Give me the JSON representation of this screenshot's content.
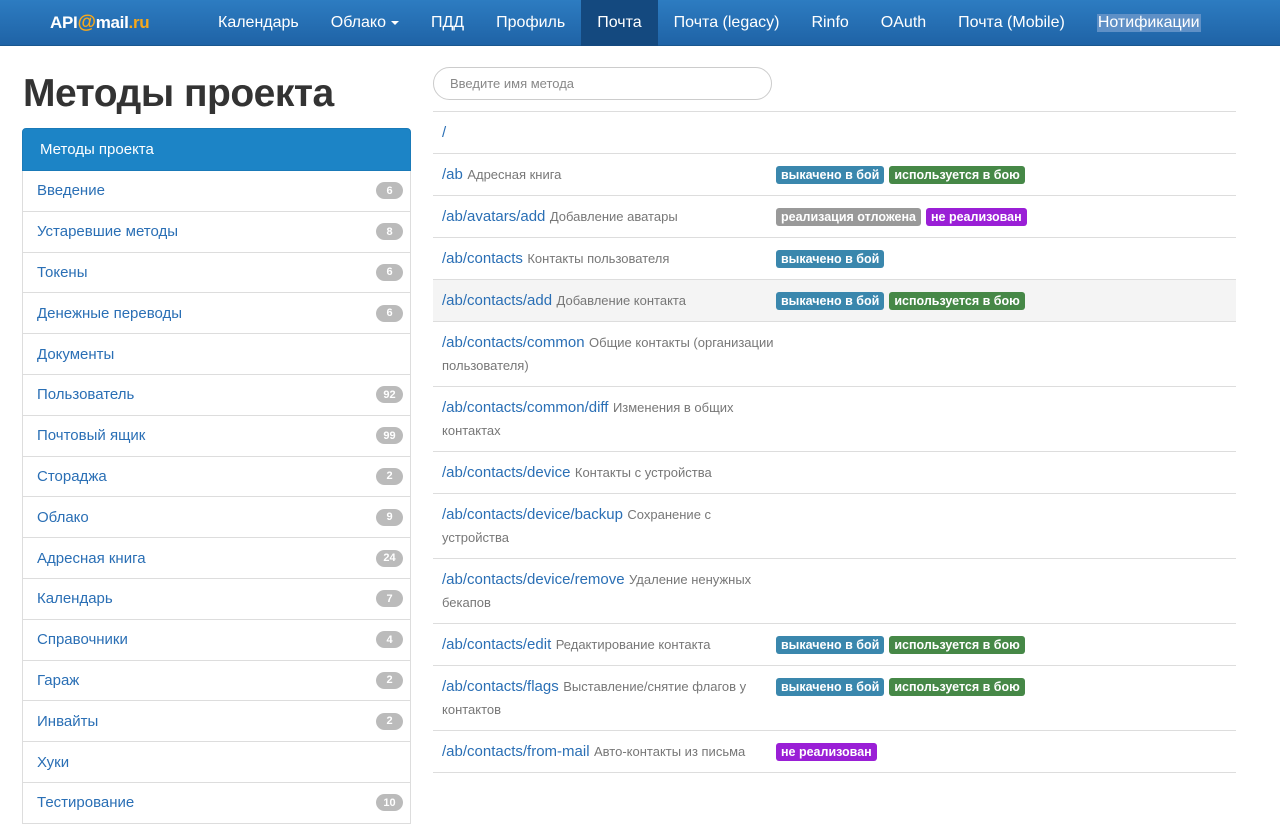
{
  "brand": {
    "api": "API",
    "at": "@",
    "mail": "mail",
    "ru": ".ru"
  },
  "nav": {
    "items": [
      {
        "label": "Календарь"
      },
      {
        "label": "Облако"
      },
      {
        "label": "ПДД"
      },
      {
        "label": "Профиль"
      },
      {
        "label": "Почта"
      },
      {
        "label": "Почта (legacy)"
      },
      {
        "label": "Rinfo"
      },
      {
        "label": "OAuth"
      },
      {
        "label": "Почта (Mobile)"
      },
      {
        "label": "Нотификации"
      }
    ],
    "active_index": 4
  },
  "page": {
    "title": "Методы проекта"
  },
  "sidebar": {
    "header": "Методы проекта",
    "items": [
      {
        "label": "Введение",
        "count": "6"
      },
      {
        "label": "Устаревшие методы",
        "count": "8"
      },
      {
        "label": "Токены",
        "count": "6"
      },
      {
        "label": "Денежные переводы",
        "count": "6"
      },
      {
        "label": "Документы",
        "count": ""
      },
      {
        "label": "Пользователь",
        "count": "92"
      },
      {
        "label": "Почтовый ящик",
        "count": "99"
      },
      {
        "label": "Стораджа",
        "count": "2"
      },
      {
        "label": "Облако",
        "count": "9"
      },
      {
        "label": "Адресная книга",
        "count": "24"
      },
      {
        "label": "Календарь",
        "count": "7"
      },
      {
        "label": "Справочники",
        "count": "4"
      },
      {
        "label": "Гараж",
        "count": "2"
      },
      {
        "label": "Инвайты",
        "count": "2"
      },
      {
        "label": "Хуки",
        "count": ""
      },
      {
        "label": "Тестирование",
        "count": "10"
      }
    ]
  },
  "search": {
    "placeholder": "Введите имя метода",
    "value": ""
  },
  "tag_colors": {
    "выкачено в бой": "#3a87ad",
    "используется в бою": "#468847",
    "реализация отложена": "#999999",
    "не реализован": "#9a1fd6"
  },
  "methods": [
    {
      "path": "/",
      "desc": "",
      "tags": []
    },
    {
      "path": "/ab",
      "desc": "Адресная книга",
      "tags": [
        "выкачено в бой",
        "используется в бою"
      ]
    },
    {
      "path": "/ab/avatars/add",
      "desc": "Добавление аватары",
      "tags": [
        "реализация отложена",
        "не реализован"
      ]
    },
    {
      "path": "/ab/contacts",
      "desc": "Контакты пользователя",
      "tags": [
        "выкачено в бой"
      ]
    },
    {
      "path": "/ab/contacts/add",
      "desc": "Добавление контакта",
      "tags": [
        "выкачено в бой",
        "используется в бою"
      ],
      "striped": true
    },
    {
      "path": "/ab/contacts/common",
      "desc": "Общие контакты (организации пользователя)",
      "tags": []
    },
    {
      "path": "/ab/contacts/common/diff",
      "desc": "Изменения в общих контактах",
      "tags": []
    },
    {
      "path": "/ab/contacts/device",
      "desc": "Контакты с устройства",
      "tags": []
    },
    {
      "path": "/ab/contacts/device/backup",
      "desc": "Сохранение с устройства",
      "tags": []
    },
    {
      "path": "/ab/contacts/device/remove",
      "desc": "Удаление ненужных бекапов",
      "tags": []
    },
    {
      "path": "/ab/contacts/edit",
      "desc": "Редактирование контакта",
      "tags": [
        "выкачено в бой",
        "используется в бою"
      ]
    },
    {
      "path": "/ab/contacts/flags",
      "desc": "Выставление/снятие флагов у контактов",
      "tags": [
        "выкачено в бой",
        "используется в бою"
      ]
    },
    {
      "path": "/ab/contacts/from-mail",
      "desc": "Авто-контакты из письма",
      "tags": [
        "не реализован"
      ]
    }
  ]
}
